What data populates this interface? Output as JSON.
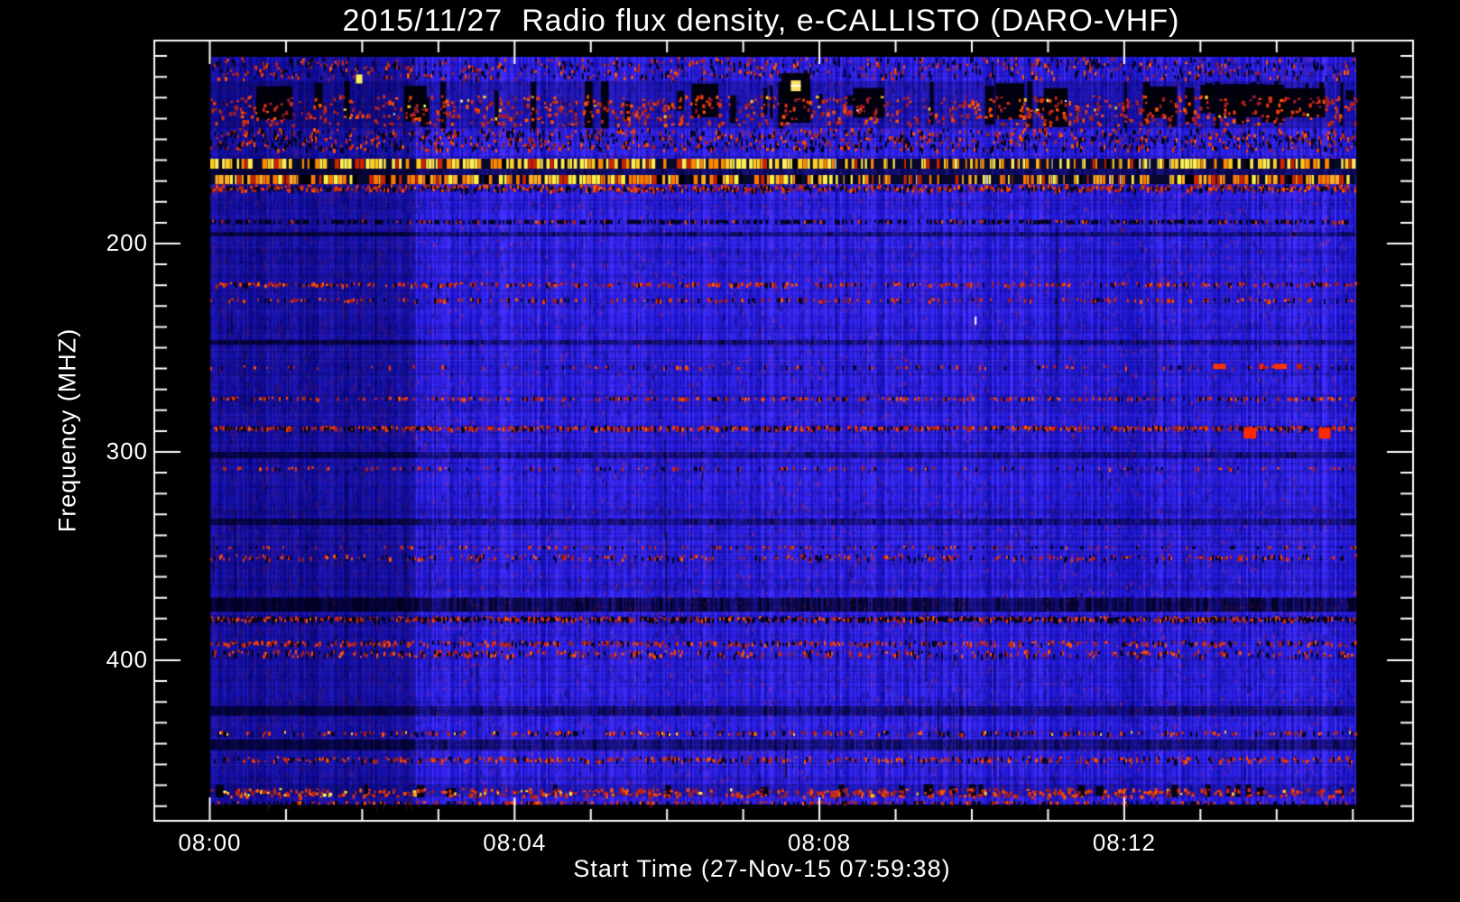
{
  "chart_data": {
    "type": "heatmap",
    "subtype": "radio_spectrogram",
    "title": "2015/11/27  Radio flux density, e-CALLISTO (DARO-VHF)",
    "xlabel": "Start Time (27-Nov-15 07:59:38)",
    "ylabel": "Frequency (MHZ)",
    "x_axis": {
      "tick_labels": [
        "08:00",
        "08:04",
        "08:08",
        "08:12"
      ],
      "major_tick_minutes": [
        0,
        4,
        8,
        12
      ],
      "minor_tick_every_minutes": 1,
      "data_span_minutes": [
        0,
        15.03
      ],
      "quiet_left_region_end_minute": 2.7
    },
    "y_axis": {
      "tick_labels": [
        "200",
        "300",
        "400"
      ],
      "major_ticks_mhz": [
        200,
        300,
        400
      ],
      "minor_tick_every_mhz": 10,
      "range_mhz": [
        110,
        470
      ],
      "direction": "increasing-downward"
    },
    "grid": "off",
    "legend": null,
    "palette": {
      "background": "#000000",
      "axis": "#ffffff",
      "body_blue": "#2020ee",
      "quiet_blue": "#16129f",
      "speckle_reds": [
        "#aa1f1f",
        "#cc2a14",
        "#e83a0a",
        "#ff5500",
        "#8f2030"
      ],
      "carrier_yellow": "#ffee55",
      "carrier_orange": "#ff9911",
      "rfi_black": "#000008",
      "bright_white": "#ffffff"
    },
    "bands": [
      {
        "name": "top-noise",
        "f": [
          110.4,
          122.0
        ],
        "type": "speckle",
        "red": 0.07,
        "black": 0.06
      },
      {
        "name": "rfi-broadband",
        "f": [
          122.0,
          144.5
        ],
        "type": "rfi",
        "black": 0.3,
        "red": 0.17,
        "yellow": 0.02,
        "white": 0.003
      },
      {
        "name": "mid-noise",
        "f": [
          144.5,
          156.0
        ],
        "type": "speckle",
        "red": 0.11,
        "black": 0.1
      },
      {
        "name": "carrier-band-1",
        "f": [
          159.3,
          164.1
        ],
        "type": "barcode",
        "palette": [
          "#ffee55",
          "#ffcc22",
          "#ff8800",
          "#cc2200",
          "#000000"
        ]
      },
      {
        "name": "carrier-gap",
        "f": [
          164.1,
          167.1
        ],
        "type": "dark",
        "a": 0.62
      },
      {
        "name": "carrier-band-2",
        "f": [
          167.1,
          171.5
        ],
        "type": "barcode",
        "palette": [
          "#ffaa22",
          "#ff7700",
          "#ffee44",
          "#cc2200",
          "#000000"
        ]
      },
      {
        "name": "speckle-row",
        "f": [
          171.5,
          175.5
        ],
        "type": "speckle",
        "red": 0.22,
        "black": 0.12
      },
      {
        "name": "texture-row",
        "f": [
          188.5,
          190.5
        ],
        "type": "speckle",
        "red": 0.07,
        "black": 0.3
      },
      {
        "name": "navy-row",
        "f": [
          194.5,
          196.5
        ],
        "type": "dark",
        "a": 0.45
      },
      {
        "name": "red-line-218",
        "f": [
          218.5,
          221.0
        ],
        "type": "speckle",
        "red": 0.24,
        "black": 0.06
      },
      {
        "name": "red-line-227",
        "f": [
          226.0,
          228.5
        ],
        "type": "speckle",
        "red": 0.13,
        "black": 0.05
      },
      {
        "name": "navy-row-247",
        "f": [
          246.3,
          248.5
        ],
        "type": "dark",
        "a": 0.42
      },
      {
        "name": "sparse-red-259",
        "f": [
          258.4,
          260.6
        ],
        "type": "speckle",
        "red": 0.05,
        "black": 0.03
      },
      {
        "name": "red-line-274",
        "f": [
          273.5,
          275.5
        ],
        "type": "speckle",
        "red": 0.19,
        "black": 0.06
      },
      {
        "name": "red-line-288",
        "f": [
          287.4,
          290.0
        ],
        "type": "speckle",
        "red": 0.27,
        "black": 0.13
      },
      {
        "name": "navy-row-301",
        "f": [
          300.0,
          303.0
        ],
        "type": "dark",
        "a": 0.4
      },
      {
        "name": "faint-red-308",
        "f": [
          307.0,
          309.0
        ],
        "type": "speckle",
        "red": 0.06,
        "black": 0.03
      },
      {
        "name": "navy-row-333",
        "f": [
          332.0,
          335.0
        ],
        "type": "dark",
        "a": 0.38
      },
      {
        "name": "faint-red-346",
        "f": [
          345.0,
          346.5
        ],
        "type": "speckle",
        "red": 0.07,
        "black": 0.04
      },
      {
        "name": "red-line-350",
        "f": [
          349.0,
          352.5
        ],
        "type": "speckle",
        "red": 0.11,
        "black": 0.05
      },
      {
        "name": "navy-streaks-373",
        "f": [
          370.0,
          376.6
        ],
        "type": "dark-streaks",
        "a": 0.55
      },
      {
        "name": "black-red-380",
        "f": [
          378.8,
          381.8
        ],
        "type": "speckle",
        "red": 0.24,
        "black": 0.28
      },
      {
        "name": "red-line-392",
        "f": [
          390.5,
          393.5
        ],
        "type": "speckle",
        "red": 0.17,
        "black": 0.07
      },
      {
        "name": "red-line-397",
        "f": [
          395.0,
          399.0
        ],
        "type": "speckle",
        "red": 0.11,
        "black": 0.06
      },
      {
        "name": "navy-row-424",
        "f": [
          422.0,
          426.5
        ],
        "type": "dark",
        "a": 0.42
      },
      {
        "name": "colored-dash-435",
        "f": [
          433.8,
          436.4
        ],
        "type": "speckle",
        "red": 0.08,
        "black": 0.06,
        "yellow": 0.012
      },
      {
        "name": "navy-row-440",
        "f": [
          438.0,
          443.0
        ],
        "type": "dark",
        "a": 0.4
      },
      {
        "name": "red-line-448",
        "f": [
          446.0,
          449.5
        ],
        "type": "speckle",
        "red": 0.17,
        "black": 0.07
      },
      {
        "name": "bottom-rfi",
        "f": [
          459.5,
          465.5
        ],
        "type": "rfi",
        "black": 0.14,
        "red": 0.4,
        "yellow": 0.025
      },
      {
        "name": "bottom-edge",
        "f": [
          467.5,
          469.3
        ],
        "type": "speckle",
        "red": 0.13,
        "black": 0.09
      }
    ],
    "rfi_black_clump_minutes": [
      0.85,
      2.7,
      6.5,
      7.7,
      8.65,
      10.5,
      11.1,
      12.45,
      13.1,
      13.55,
      13.95,
      14.35
    ],
    "features": [
      {
        "name": "yellow-blob",
        "t_min": 1.96,
        "f_mhz": 121.0,
        "w": 7,
        "h": 10,
        "color": "#ffee55"
      },
      {
        "name": "yellow-white-blob",
        "t_min": 7.69,
        "f_mhz": 124.3,
        "w": 11,
        "h": 12,
        "color": "#ffe066"
      },
      {
        "name": "white-tick",
        "t_min": 10.05,
        "f_mhz": 237.0,
        "w": 2,
        "h": 9,
        "color": "#ffffff"
      },
      {
        "name": "red-dash",
        "t_min": 13.25,
        "f_mhz": 259.0,
        "w": 14,
        "h": 6,
        "color": "#ff3300"
      },
      {
        "name": "red-dash",
        "t_min": 13.8,
        "f_mhz": 259.0,
        "w": 5,
        "h": 6,
        "color": "#ff2200"
      },
      {
        "name": "red-dash",
        "t_min": 14.05,
        "f_mhz": 259.0,
        "w": 14,
        "h": 6,
        "color": "#ff3300"
      },
      {
        "name": "red-dash",
        "t_min": 14.3,
        "f_mhz": 259.0,
        "w": 6,
        "h": 6,
        "color": "#cc2200"
      },
      {
        "name": "red-blob",
        "t_min": 13.65,
        "f_mhz": 291.0,
        "w": 14,
        "h": 12,
        "color": "#ff2a00"
      },
      {
        "name": "red-blob",
        "t_min": 14.63,
        "f_mhz": 291.0,
        "w": 13,
        "h": 12,
        "color": "#ff2a00"
      }
    ]
  }
}
